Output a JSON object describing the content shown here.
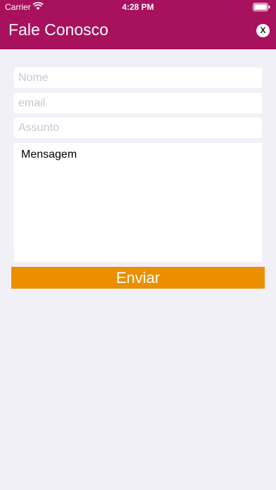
{
  "status_bar": {
    "carrier": "Carrier",
    "time": "4:28 PM"
  },
  "header": {
    "title": "Fale Conosco",
    "close_label": "X",
    "color": "#a8115e"
  },
  "form": {
    "name_placeholder": "Nome",
    "email_placeholder": "email",
    "subject_placeholder": "Assunto",
    "message_text": "Mensagem",
    "send_label": "Enviar",
    "send_color": "#eb8f00"
  }
}
